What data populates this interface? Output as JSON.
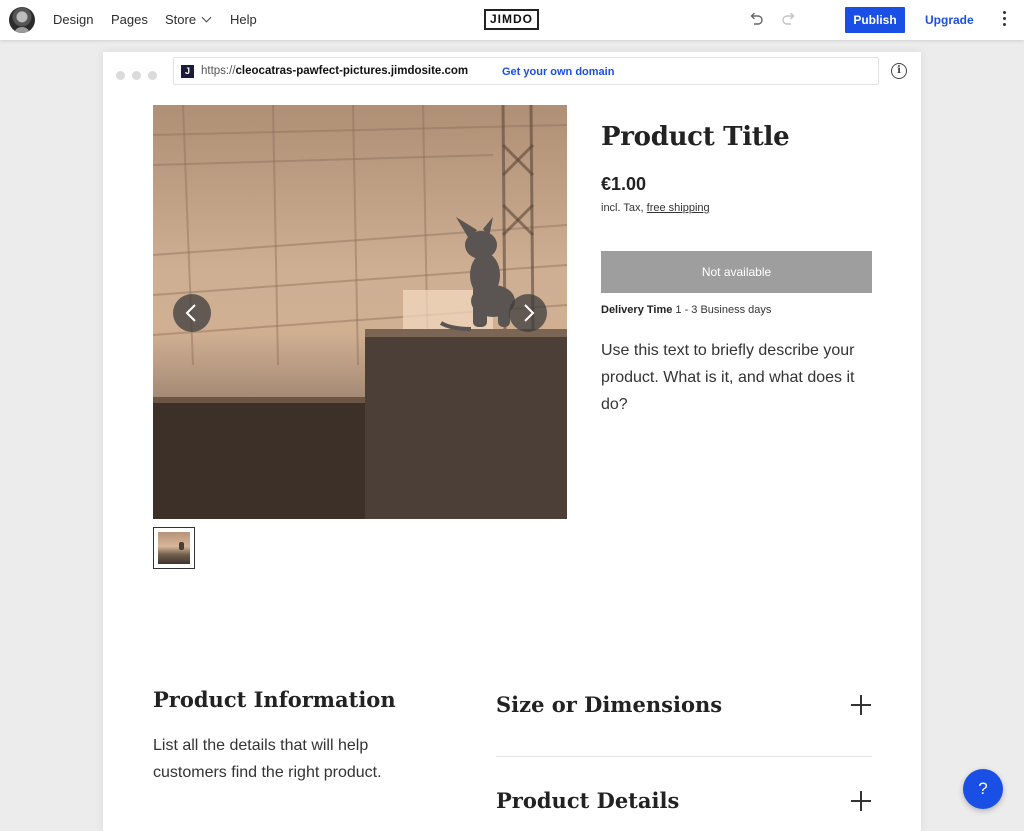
{
  "topbar": {
    "nav": {
      "design": "Design",
      "pages": "Pages",
      "store": "Store",
      "help": "Help"
    },
    "logo": "JIMDO",
    "publish_label": "Publish",
    "upgrade_label": "Upgrade",
    "icons": {
      "undo": "undo-icon",
      "redo": "redo-icon",
      "more": "more-vertical-icon",
      "store_dropdown": "chevron-down-icon"
    }
  },
  "browser": {
    "favicon": "J",
    "url_protocol": "https://",
    "url_domain": "cleocatras-pawfect-pictures.jimdosite.com",
    "domain_link": "Get your own domain",
    "info_icon": "i"
  },
  "product": {
    "title": "Product Title",
    "price": "€1.00",
    "tax_prefix": "incl. Tax,",
    "shipping_link": "free shipping",
    "buy_button": "Not available",
    "delivery_label": "Delivery Time",
    "delivery_value": "1 - 3 Business days",
    "description": "Use this text to briefly describe your product. What is it, and what does it do?"
  },
  "info_section": {
    "heading": "Product Information",
    "text": "List all the details that will help customers find the right product."
  },
  "accordion": [
    {
      "title": "Size or Dimensions"
    },
    {
      "title": "Product Details"
    }
  ],
  "help_button": "?",
  "colors": {
    "accent": "#1a4fe6",
    "disabled_button": "#9e9e9e",
    "canvas": "#ececec"
  }
}
